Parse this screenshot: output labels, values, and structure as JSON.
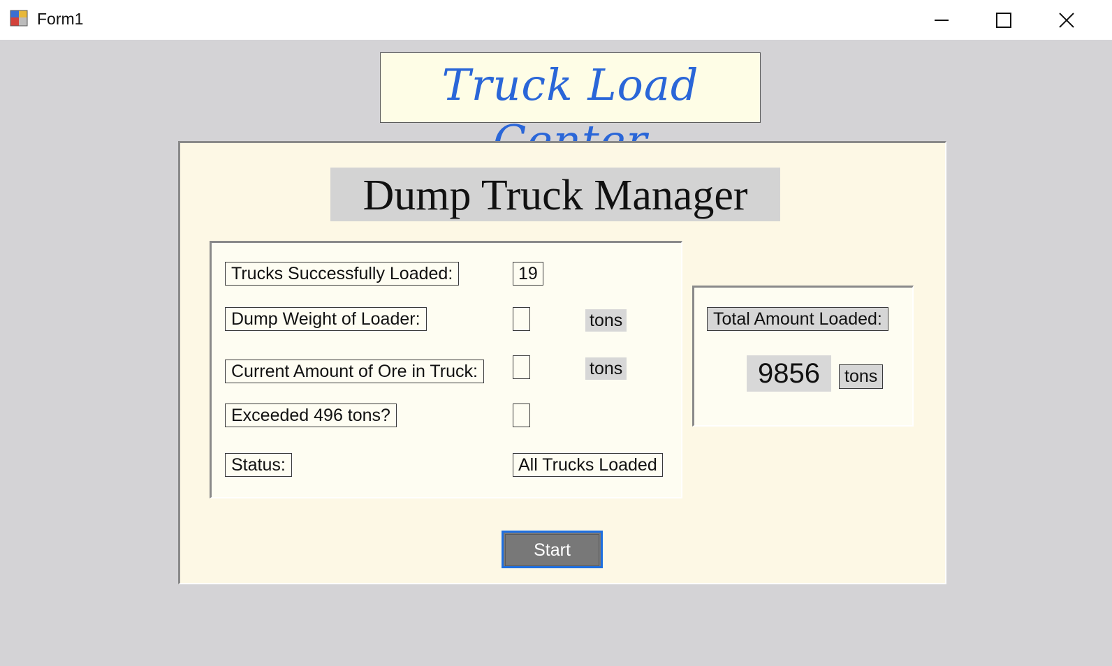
{
  "window": {
    "title": "Form1",
    "icon": "winforms-app-icon",
    "controls": [
      "minimize-icon",
      "maximize-icon",
      "close-icon"
    ]
  },
  "banner": {
    "text": "Truck Load Center",
    "color": "#2a66d8"
  },
  "heading": {
    "text": "Dump Truck Manager"
  },
  "fields": {
    "trucks_loaded": {
      "label": "Trucks Successfully Loaded:",
      "value": "19"
    },
    "dump_weight": {
      "label": "Dump Weight of Loader:",
      "value": "",
      "unit": "tons"
    },
    "current_amount": {
      "label": "Current Amount of Ore in Truck:",
      "value": "",
      "unit": "tons"
    },
    "exceeded": {
      "label": "Exceeded 496 tons?",
      "value": ""
    },
    "status": {
      "label": "Status:",
      "value": "All Trucks Loaded"
    }
  },
  "total": {
    "label": "Total Amount Loaded:",
    "value": "9856",
    "unit": "tons"
  },
  "start_button": {
    "label": "Start",
    "focus_color": "#1e6fe0"
  }
}
